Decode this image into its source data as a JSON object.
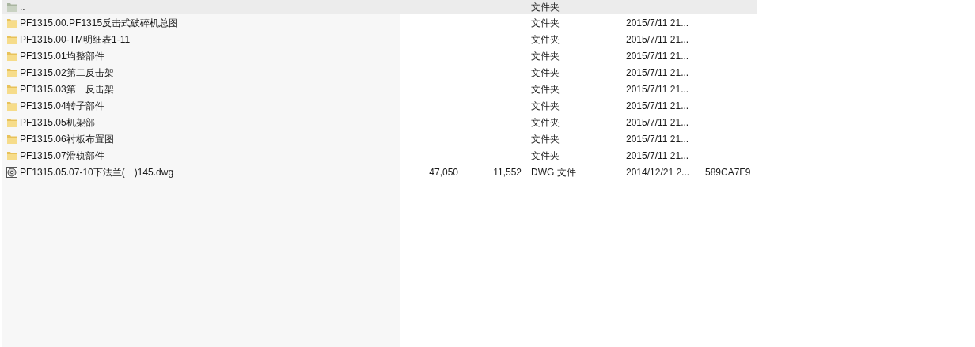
{
  "file_list": {
    "rows": [
      {
        "kind": "parent",
        "name": "..",
        "type": "文件夹",
        "selected": true
      },
      {
        "kind": "folder",
        "name": "PF1315.00.PF1315反击式破碎机总图",
        "type": "文件夹",
        "modified": "2015/7/11 21...",
        "selected": false
      },
      {
        "kind": "folder",
        "name": "PF1315.00-TM明细表1-11",
        "type": "文件夹",
        "modified": "2015/7/11 21...",
        "selected": false
      },
      {
        "kind": "folder",
        "name": "PF1315.01均整部件",
        "type": "文件夹",
        "modified": "2015/7/11 21...",
        "selected": false
      },
      {
        "kind": "folder",
        "name": "PF1315.02第二反击架",
        "type": "文件夹",
        "modified": "2015/7/11 21...",
        "selected": false
      },
      {
        "kind": "folder",
        "name": "PF1315.03第一反击架",
        "type": "文件夹",
        "modified": "2015/7/11 21...",
        "selected": false
      },
      {
        "kind": "folder",
        "name": "PF1315.04转子部件",
        "type": "文件夹",
        "modified": "2015/7/11 21...",
        "selected": false
      },
      {
        "kind": "folder",
        "name": "PF1315.05机架部",
        "type": "文件夹",
        "modified": "2015/7/11 21...",
        "selected": false
      },
      {
        "kind": "folder",
        "name": "PF1315.06衬板布置图",
        "type": "文件夹",
        "modified": "2015/7/11 21...",
        "selected": false
      },
      {
        "kind": "folder",
        "name": "PF1315.07滑轨部件",
        "type": "文件夹",
        "modified": "2015/7/11 21...",
        "selected": false
      },
      {
        "kind": "file",
        "name": "PF1315.05.07-10下法兰(一)145.dwg",
        "size": "47,050",
        "packed": "11,552",
        "type": "DWG 文件",
        "modified": "2014/12/21 2...",
        "crc": "589CA7F9",
        "selected": false
      }
    ]
  }
}
